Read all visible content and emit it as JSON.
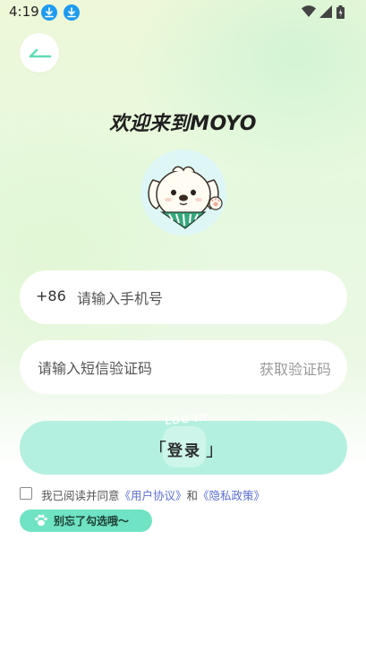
{
  "status_bar": {
    "time": "4:19",
    "icons": [
      "download-icon",
      "download-icon",
      "wifi-icon",
      "signal-icon",
      "battery-icon"
    ]
  },
  "header": {
    "back_icon": "back-arrow-icon"
  },
  "title": "欢迎来到MOYO",
  "avatar": {
    "icon": "puppy-mascot"
  },
  "phone_field": {
    "country_code": "+86",
    "placeholder": "请输入手机号",
    "value": ""
  },
  "sms_field": {
    "placeholder": "请输入短信验证码",
    "value": "",
    "get_code_label": "获取验证码"
  },
  "login_button": {
    "label": "登录",
    "bracket_left": "「",
    "bracket_right": "」",
    "decoration_text": "LOG IN"
  },
  "agreement": {
    "prefix": "我已阅读并同意",
    "user_agreement": "《用户协议》",
    "conjunction": "和",
    "privacy_policy": "《隐私政策》",
    "checked": false
  },
  "reminder": {
    "text": "别忘了勾选哦～",
    "icon": "paw-icon"
  },
  "colors": {
    "accent": "#b3f0df",
    "reminder_bg": "#6fe3c4",
    "link": "#5b6fd6",
    "status_download": "#1e9bf0"
  }
}
